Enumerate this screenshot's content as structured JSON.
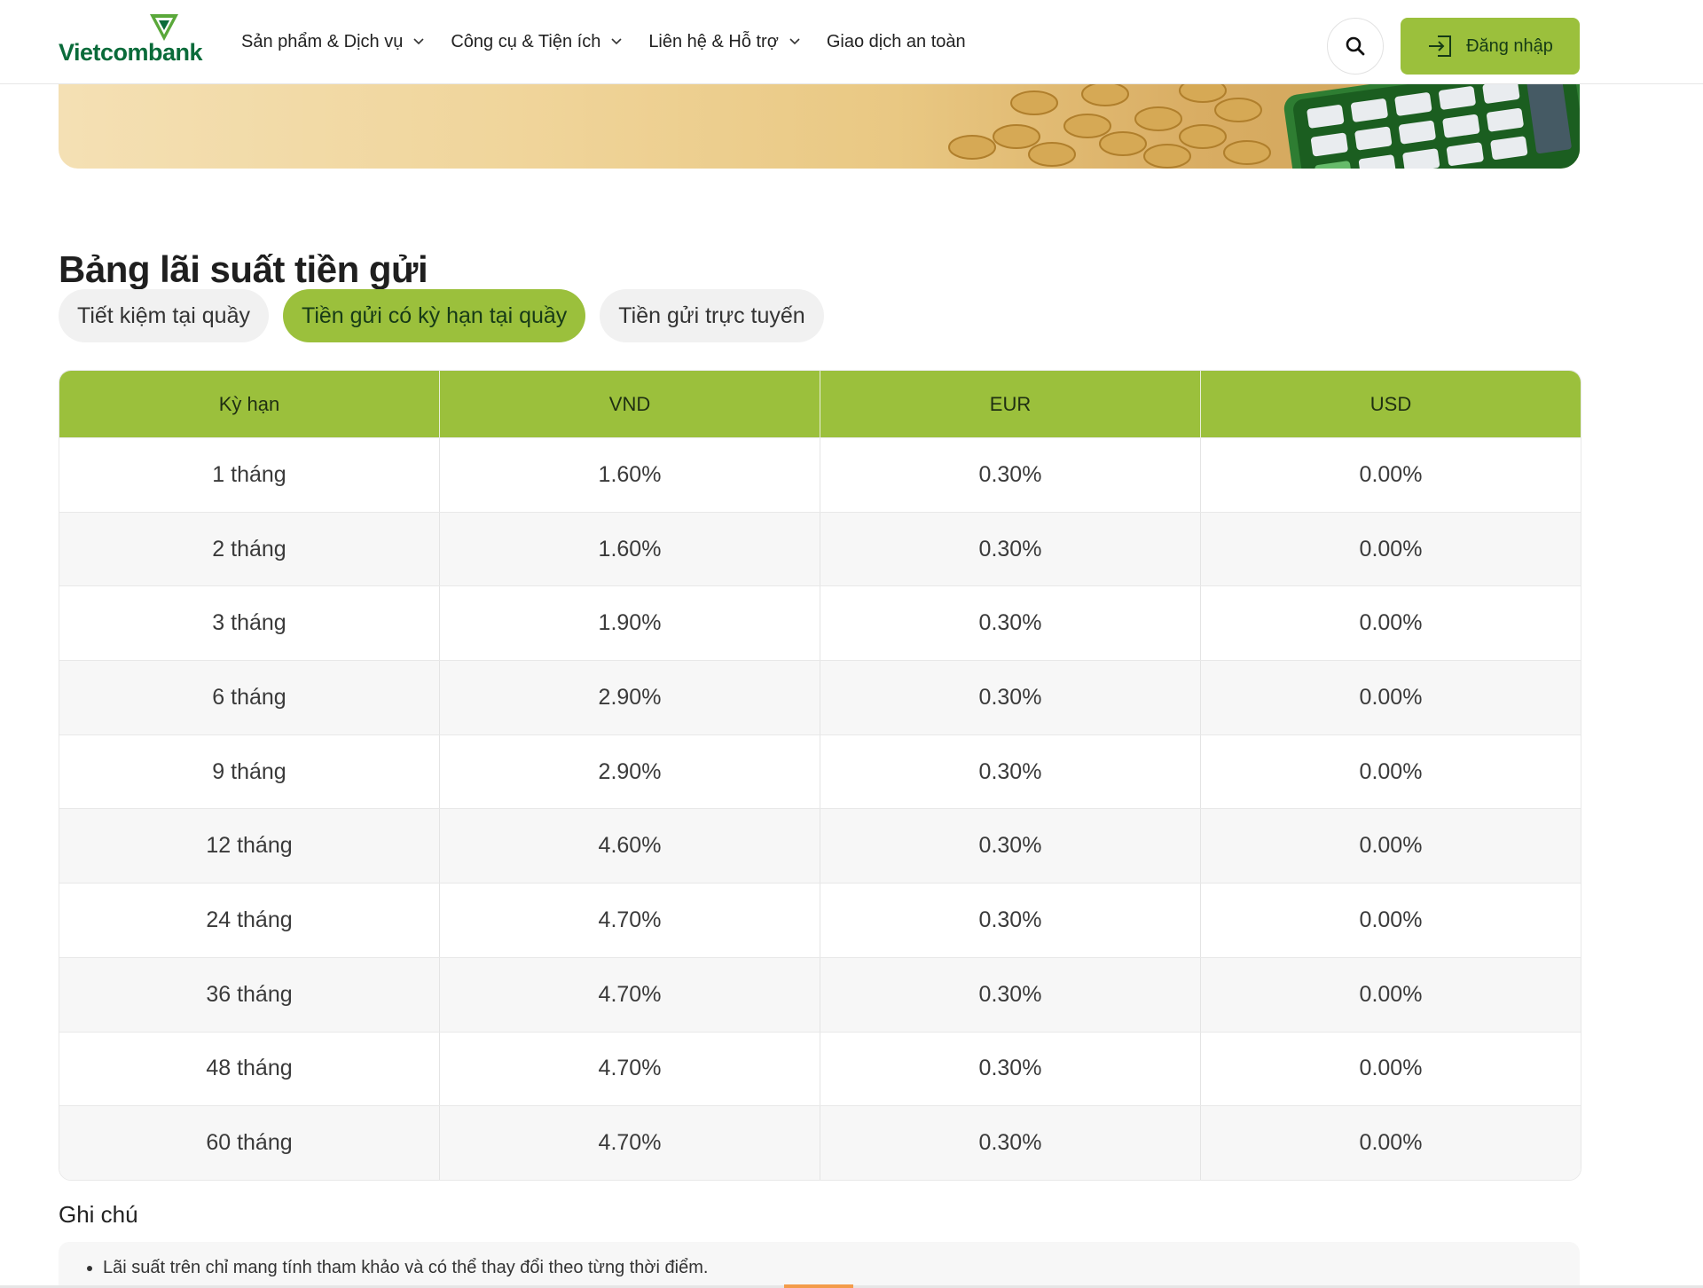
{
  "brand": {
    "logo_text": "Vietcombank",
    "colors": {
      "primary_green": "#9bc03c",
      "logo_green": "#0a6b3a",
      "accent_orange": "#f39c4a"
    }
  },
  "nav": {
    "items": [
      {
        "label": "Sản phẩm & Dịch vụ",
        "dropdown": true
      },
      {
        "label": "Công cụ & Tiện ích",
        "dropdown": true
      },
      {
        "label": "Liên hệ & Hỗ trợ",
        "dropdown": true
      },
      {
        "label": "Giao dịch an toàn",
        "dropdown": false
      }
    ],
    "search_icon": "search-icon",
    "login_icon": "login-icon",
    "login_label": "Đăng nhập"
  },
  "page": {
    "title": "Bảng lãi suất tiền gửi"
  },
  "tabs": [
    {
      "label": "Tiết kiệm tại quầy",
      "active": false
    },
    {
      "label": "Tiền gửi có kỳ hạn tại quầy",
      "active": true
    },
    {
      "label": "Tiền gửi trực tuyến",
      "active": false
    }
  ],
  "table": {
    "headers": [
      "Kỳ hạn",
      "VND",
      "EUR",
      "USD"
    ],
    "rows": [
      [
        "1 tháng",
        "1.60%",
        "0.30%",
        "0.00%"
      ],
      [
        "2 tháng",
        "1.60%",
        "0.30%",
        "0.00%"
      ],
      [
        "3 tháng",
        "1.90%",
        "0.30%",
        "0.00%"
      ],
      [
        "6 tháng",
        "2.90%",
        "0.30%",
        "0.00%"
      ],
      [
        "9 tháng",
        "2.90%",
        "0.30%",
        "0.00%"
      ],
      [
        "12 tháng",
        "4.60%",
        "0.30%",
        "0.00%"
      ],
      [
        "24 tháng",
        "4.70%",
        "0.30%",
        "0.00%"
      ],
      [
        "36 tháng",
        "4.70%",
        "0.30%",
        "0.00%"
      ],
      [
        "48 tháng",
        "4.70%",
        "0.30%",
        "0.00%"
      ],
      [
        "60 tháng",
        "4.70%",
        "0.30%",
        "0.00%"
      ]
    ]
  },
  "notes": {
    "title": "Ghi chú",
    "items": [
      "Lãi suất trên chỉ mang tính tham khảo và có thể thay đổi theo từng thời điểm."
    ]
  }
}
